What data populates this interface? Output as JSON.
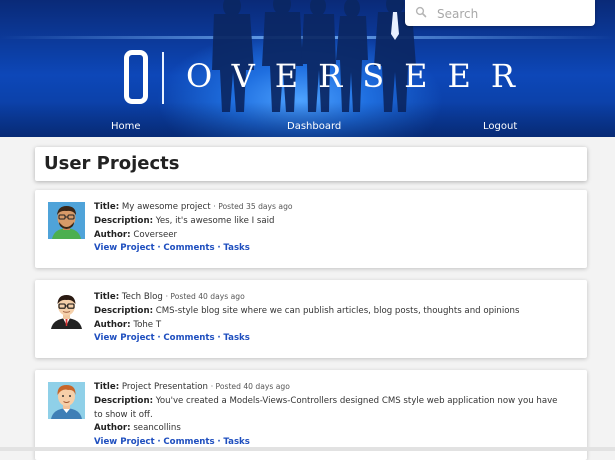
{
  "header": {
    "logo_letter": "O",
    "logo_text": "OVERSEER",
    "search_placeholder": "Search",
    "nav": {
      "home": "Home",
      "dashboard": "Dashboard",
      "logout": "Logout"
    }
  },
  "page_title": "User Projects",
  "projects": [
    {
      "title_label": "Title:",
      "title": "My awesome project",
      "posted": "· Posted 35 days ago",
      "description_label": "Description:",
      "description": "Yes, it's awesome like I said",
      "author_label": "Author:",
      "author": "Coverseer",
      "links": {
        "view": "View Project",
        "comments": "Comments",
        "tasks": "Tasks",
        "sep": "·"
      },
      "avatar_icon": "man-with-glasses-green-shirt-avatar"
    },
    {
      "title_label": "Title:",
      "title": "Tech Blog",
      "posted": "· Posted 40 days ago",
      "description_label": "Description:",
      "description": "CMS-style blog site where we can publish articles, blog posts, thoughts and opinions",
      "author_label": "Author:",
      "author": "Tohe T",
      "links": {
        "view": "View Project",
        "comments": "Comments",
        "tasks": "Tasks",
        "sep": "·"
      },
      "avatar_icon": "man-with-glasses-suit-avatar"
    },
    {
      "title_label": "Title:",
      "title": "Project Presentation",
      "posted": "· Posted 40 days ago",
      "description_label": "Description:",
      "description": "You've created a Models-Views-Controllers designed CMS style web application now you have to show it off.",
      "author_label": "Author:",
      "author": "seancollins",
      "links": {
        "view": "View Project",
        "comments": "Comments",
        "tasks": "Tasks",
        "sep": "·"
      },
      "avatar_icon": "red-haired-man-avatar"
    }
  ],
  "colors": {
    "banner": "#0d47b8",
    "link": "#1f4fbf",
    "background": "#f3f3f3"
  }
}
